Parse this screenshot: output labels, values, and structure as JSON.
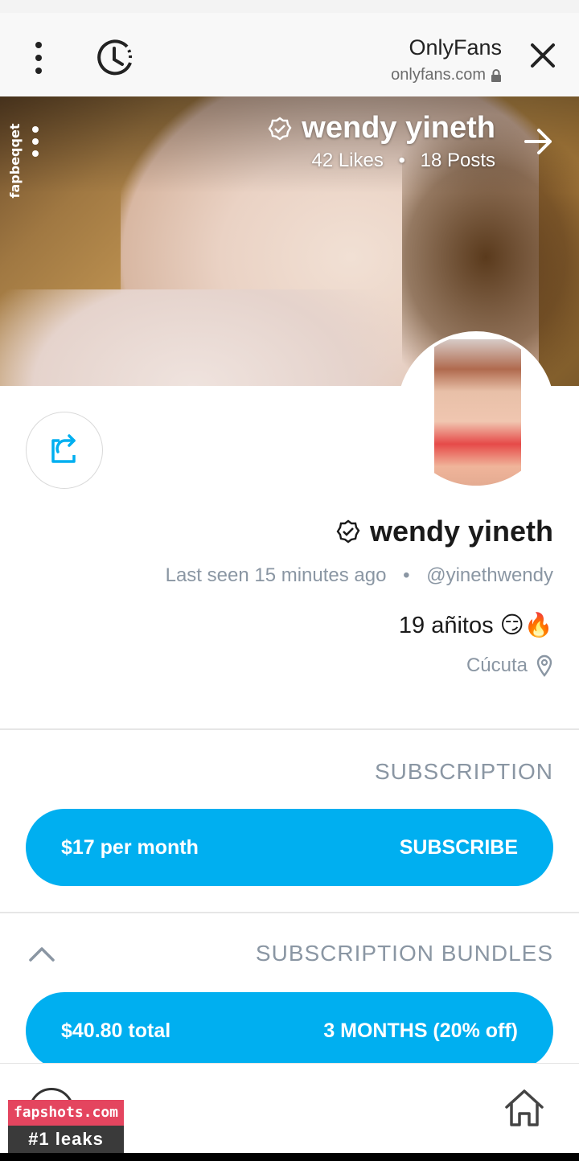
{
  "browser": {
    "title": "OnlyFans",
    "domain": "onlyfans.com"
  },
  "cover": {
    "name": "wendy yineth",
    "posts": "18 Posts",
    "separator": "•",
    "likes": "42 Likes"
  },
  "profile": {
    "name": "wendy yineth",
    "handle": "@yinethwendy",
    "separator": "•",
    "last_seen": "Last seen 15 minutes ago",
    "bio": "19 añitos 😏🔥",
    "location": "Cúcuta"
  },
  "subscription": {
    "title": "SUBSCRIPTION",
    "button_label": "SUBSCRIBE",
    "button_price": "$17 per month"
  },
  "bundles": {
    "title": "SUBSCRIPTION BUNDLES",
    "items": [
      {
        "label": "3 MONTHS (20% off)",
        "price": "$40.80 total"
      }
    ]
  },
  "watermark": {
    "site": "fapshots.com",
    "tagline": "#1 leaks",
    "side_text": "fapbeqqet"
  },
  "colors": {
    "accent": "#00aff0",
    "muted_text": "#8a96a3",
    "watermark_pink": "#e4455f"
  }
}
